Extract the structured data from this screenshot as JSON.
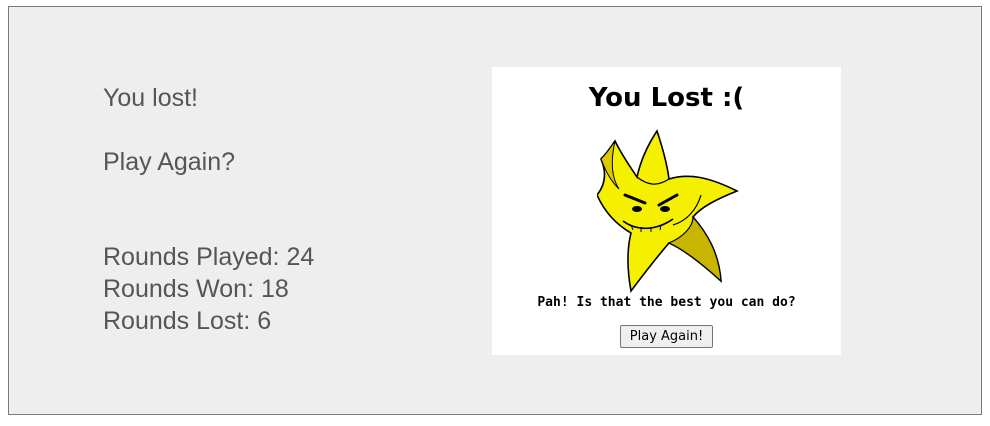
{
  "status": {
    "result_text": "You lost!",
    "prompt_text": "Play Again?"
  },
  "stats": {
    "rounds_played": "Rounds Played: 24",
    "rounds_won": "Rounds Won: 18",
    "rounds_lost": "Rounds Lost: 6"
  },
  "game_panel": {
    "title": "You Lost :(",
    "mascot": "angry-yellow-star",
    "taunt": "Pah! Is that the best you can do?",
    "button_label": "Play Again!"
  },
  "colors": {
    "background": "#eeeeee",
    "text": "#555555",
    "star_fill": "#f5ef00",
    "star_shadow": "#c7b500"
  }
}
